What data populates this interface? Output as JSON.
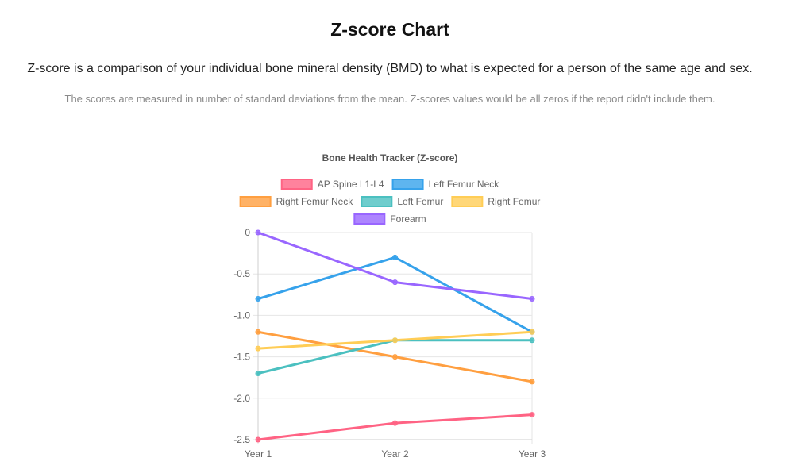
{
  "page": {
    "title": "Z-score Chart",
    "intro": "Z-score is a comparison of your individual bone mineral density (BMD) to what is expected for a person of the same age and sex.",
    "note": "The scores are measured in number of standard deviations from the mean. Z-scores values would be all zeros if the report didn't include them."
  },
  "chart_data": {
    "type": "line",
    "title": "Bone Health Tracker (Z-score)",
    "categories": [
      "Year 1",
      "Year 2",
      "Year 3"
    ],
    "ylim": [
      -2.5,
      0
    ],
    "yticks": [
      0,
      -0.5,
      -1.0,
      -1.5,
      -2.0,
      -2.5
    ],
    "ytick_labels": [
      "0",
      "-0.5",
      "-1.0",
      "-1.5",
      "-2.0",
      "-2.5"
    ],
    "grid": true,
    "legend_position": "top",
    "series": [
      {
        "name": "AP Spine L1-L4",
        "color": "#ff6384",
        "values": [
          -2.5,
          -2.3,
          -2.2
        ]
      },
      {
        "name": "Left Femur Neck",
        "color": "#36a2eb",
        "values": [
          -0.8,
          -0.3,
          -1.2
        ]
      },
      {
        "name": "Right Femur Neck",
        "color": "#ff9f40",
        "values": [
          -1.2,
          -1.5,
          -1.8
        ]
      },
      {
        "name": "Left Femur",
        "color": "#4bc0c0",
        "values": [
          -1.7,
          -1.3,
          -1.3
        ]
      },
      {
        "name": "Right Femur",
        "color": "#ffcd56",
        "values": [
          -1.4,
          -1.3,
          -1.2
        ]
      },
      {
        "name": "Forearm",
        "color": "#9966ff",
        "values": [
          0,
          -0.6,
          -0.8
        ]
      }
    ]
  }
}
